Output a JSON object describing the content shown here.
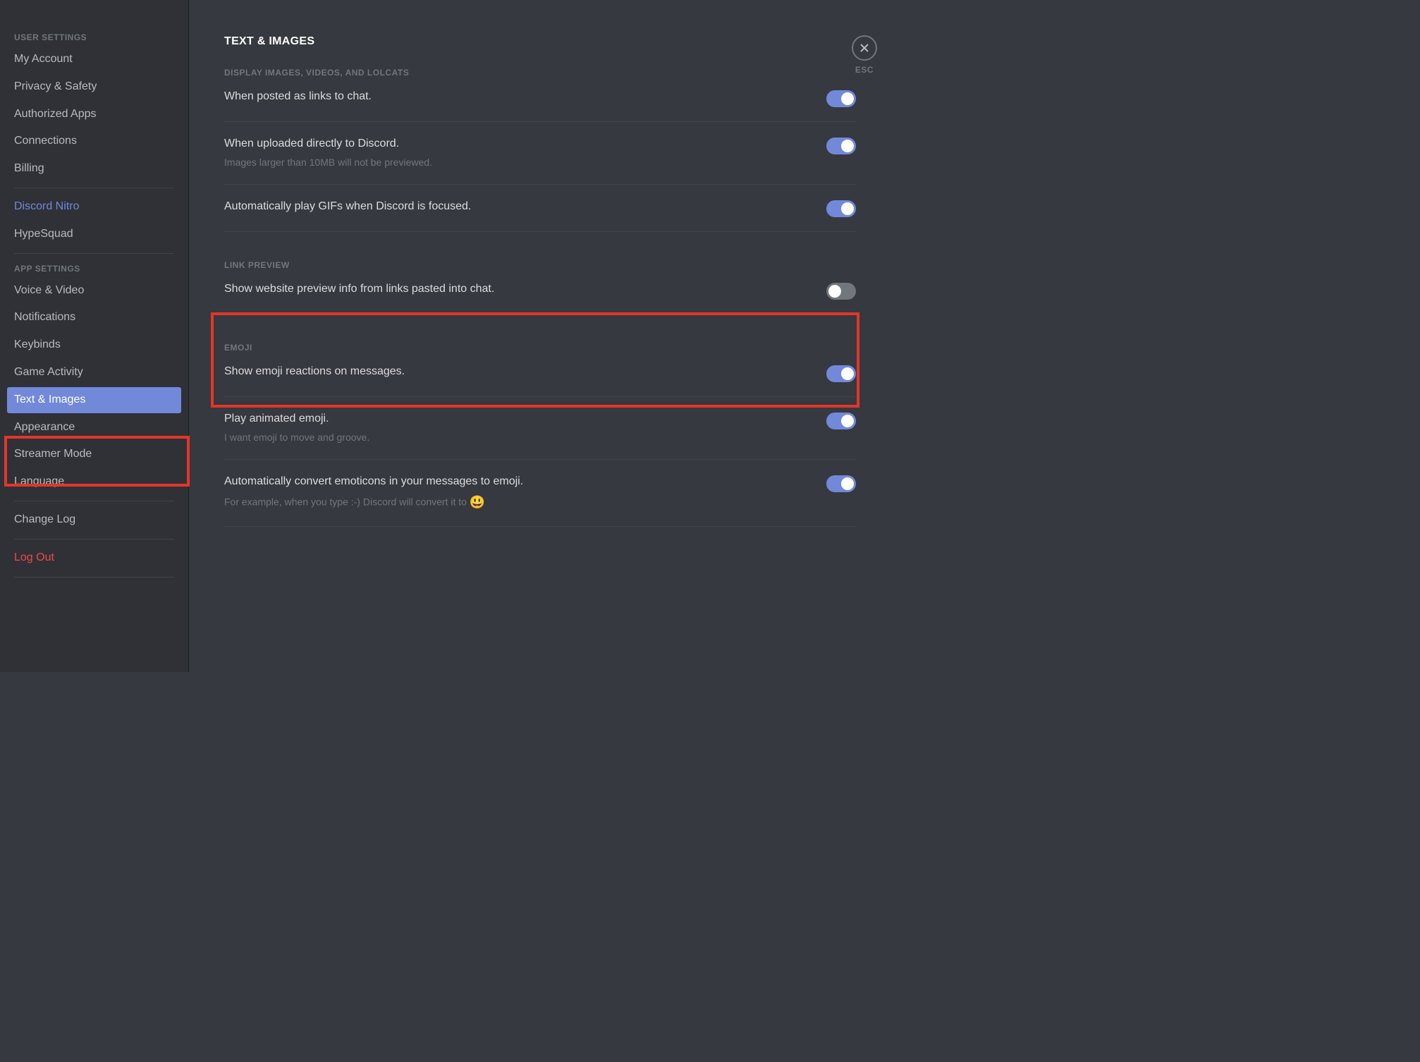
{
  "sidebar": {
    "userSettingsHeader": "USER SETTINGS",
    "appSettingsHeader": "APP SETTINGS",
    "items": {
      "myAccount": "My Account",
      "privacySafety": "Privacy & Safety",
      "authorizedApps": "Authorized Apps",
      "connections": "Connections",
      "billing": "Billing",
      "discordNitro": "Discord Nitro",
      "hypeSquad": "HypeSquad",
      "voiceVideo": "Voice & Video",
      "notifications": "Notifications",
      "keybinds": "Keybinds",
      "gameActivity": "Game Activity",
      "textImages": "Text & Images",
      "appearance": "Appearance",
      "streamerMode": "Streamer Mode",
      "language": "Language",
      "changeLog": "Change Log",
      "logOut": "Log Out"
    }
  },
  "close": {
    "label": "ESC"
  },
  "content": {
    "title": "TEXT & IMAGES",
    "sections": {
      "display": {
        "header": "DISPLAY IMAGES, VIDEOS, AND LOLCATS",
        "rows": [
          {
            "label": "When posted as links to chat.",
            "desc": "",
            "on": true
          },
          {
            "label": "When uploaded directly to Discord.",
            "desc": "Images larger than 10MB will not be previewed.",
            "on": true
          },
          {
            "label": "Automatically play GIFs when Discord is focused.",
            "desc": "",
            "on": true
          }
        ]
      },
      "linkPreview": {
        "header": "LINK PREVIEW",
        "rows": [
          {
            "label": "Show website preview info from links pasted into chat.",
            "desc": "",
            "on": false
          }
        ]
      },
      "emoji": {
        "header": "EMOJI",
        "rows": [
          {
            "label": "Show emoji reactions on messages.",
            "desc": "",
            "on": true
          },
          {
            "label": "Play animated emoji.",
            "desc": "I want emoji to move and groove.",
            "on": true
          },
          {
            "label": "Automatically convert emoticons in your messages to emoji.",
            "desc": "For example, when you type :-) Discord will convert it to ",
            "emoji": "😃",
            "on": true
          }
        ]
      }
    }
  }
}
